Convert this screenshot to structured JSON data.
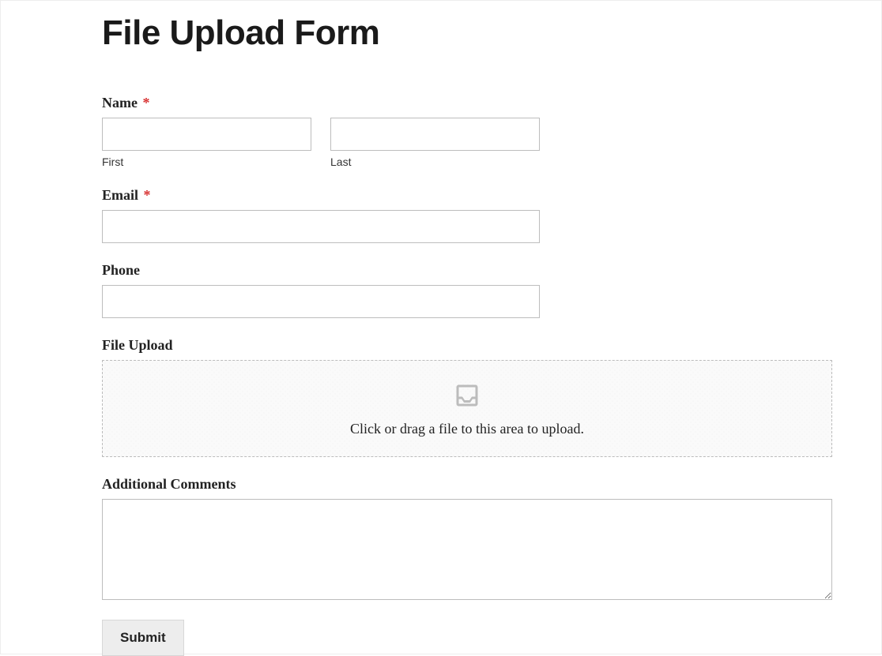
{
  "title": "File Upload Form",
  "required_marker": "*",
  "fields": {
    "name": {
      "label": "Name",
      "required": true,
      "first": {
        "sublabel": "First",
        "value": ""
      },
      "last": {
        "sublabel": "Last",
        "value": ""
      }
    },
    "email": {
      "label": "Email",
      "required": true,
      "value": ""
    },
    "phone": {
      "label": "Phone",
      "required": false,
      "value": ""
    },
    "file_upload": {
      "label": "File Upload",
      "drop_text": "Click or drag a file to this area to upload."
    },
    "comments": {
      "label": "Additional Comments",
      "value": ""
    }
  },
  "submit_label": "Submit"
}
